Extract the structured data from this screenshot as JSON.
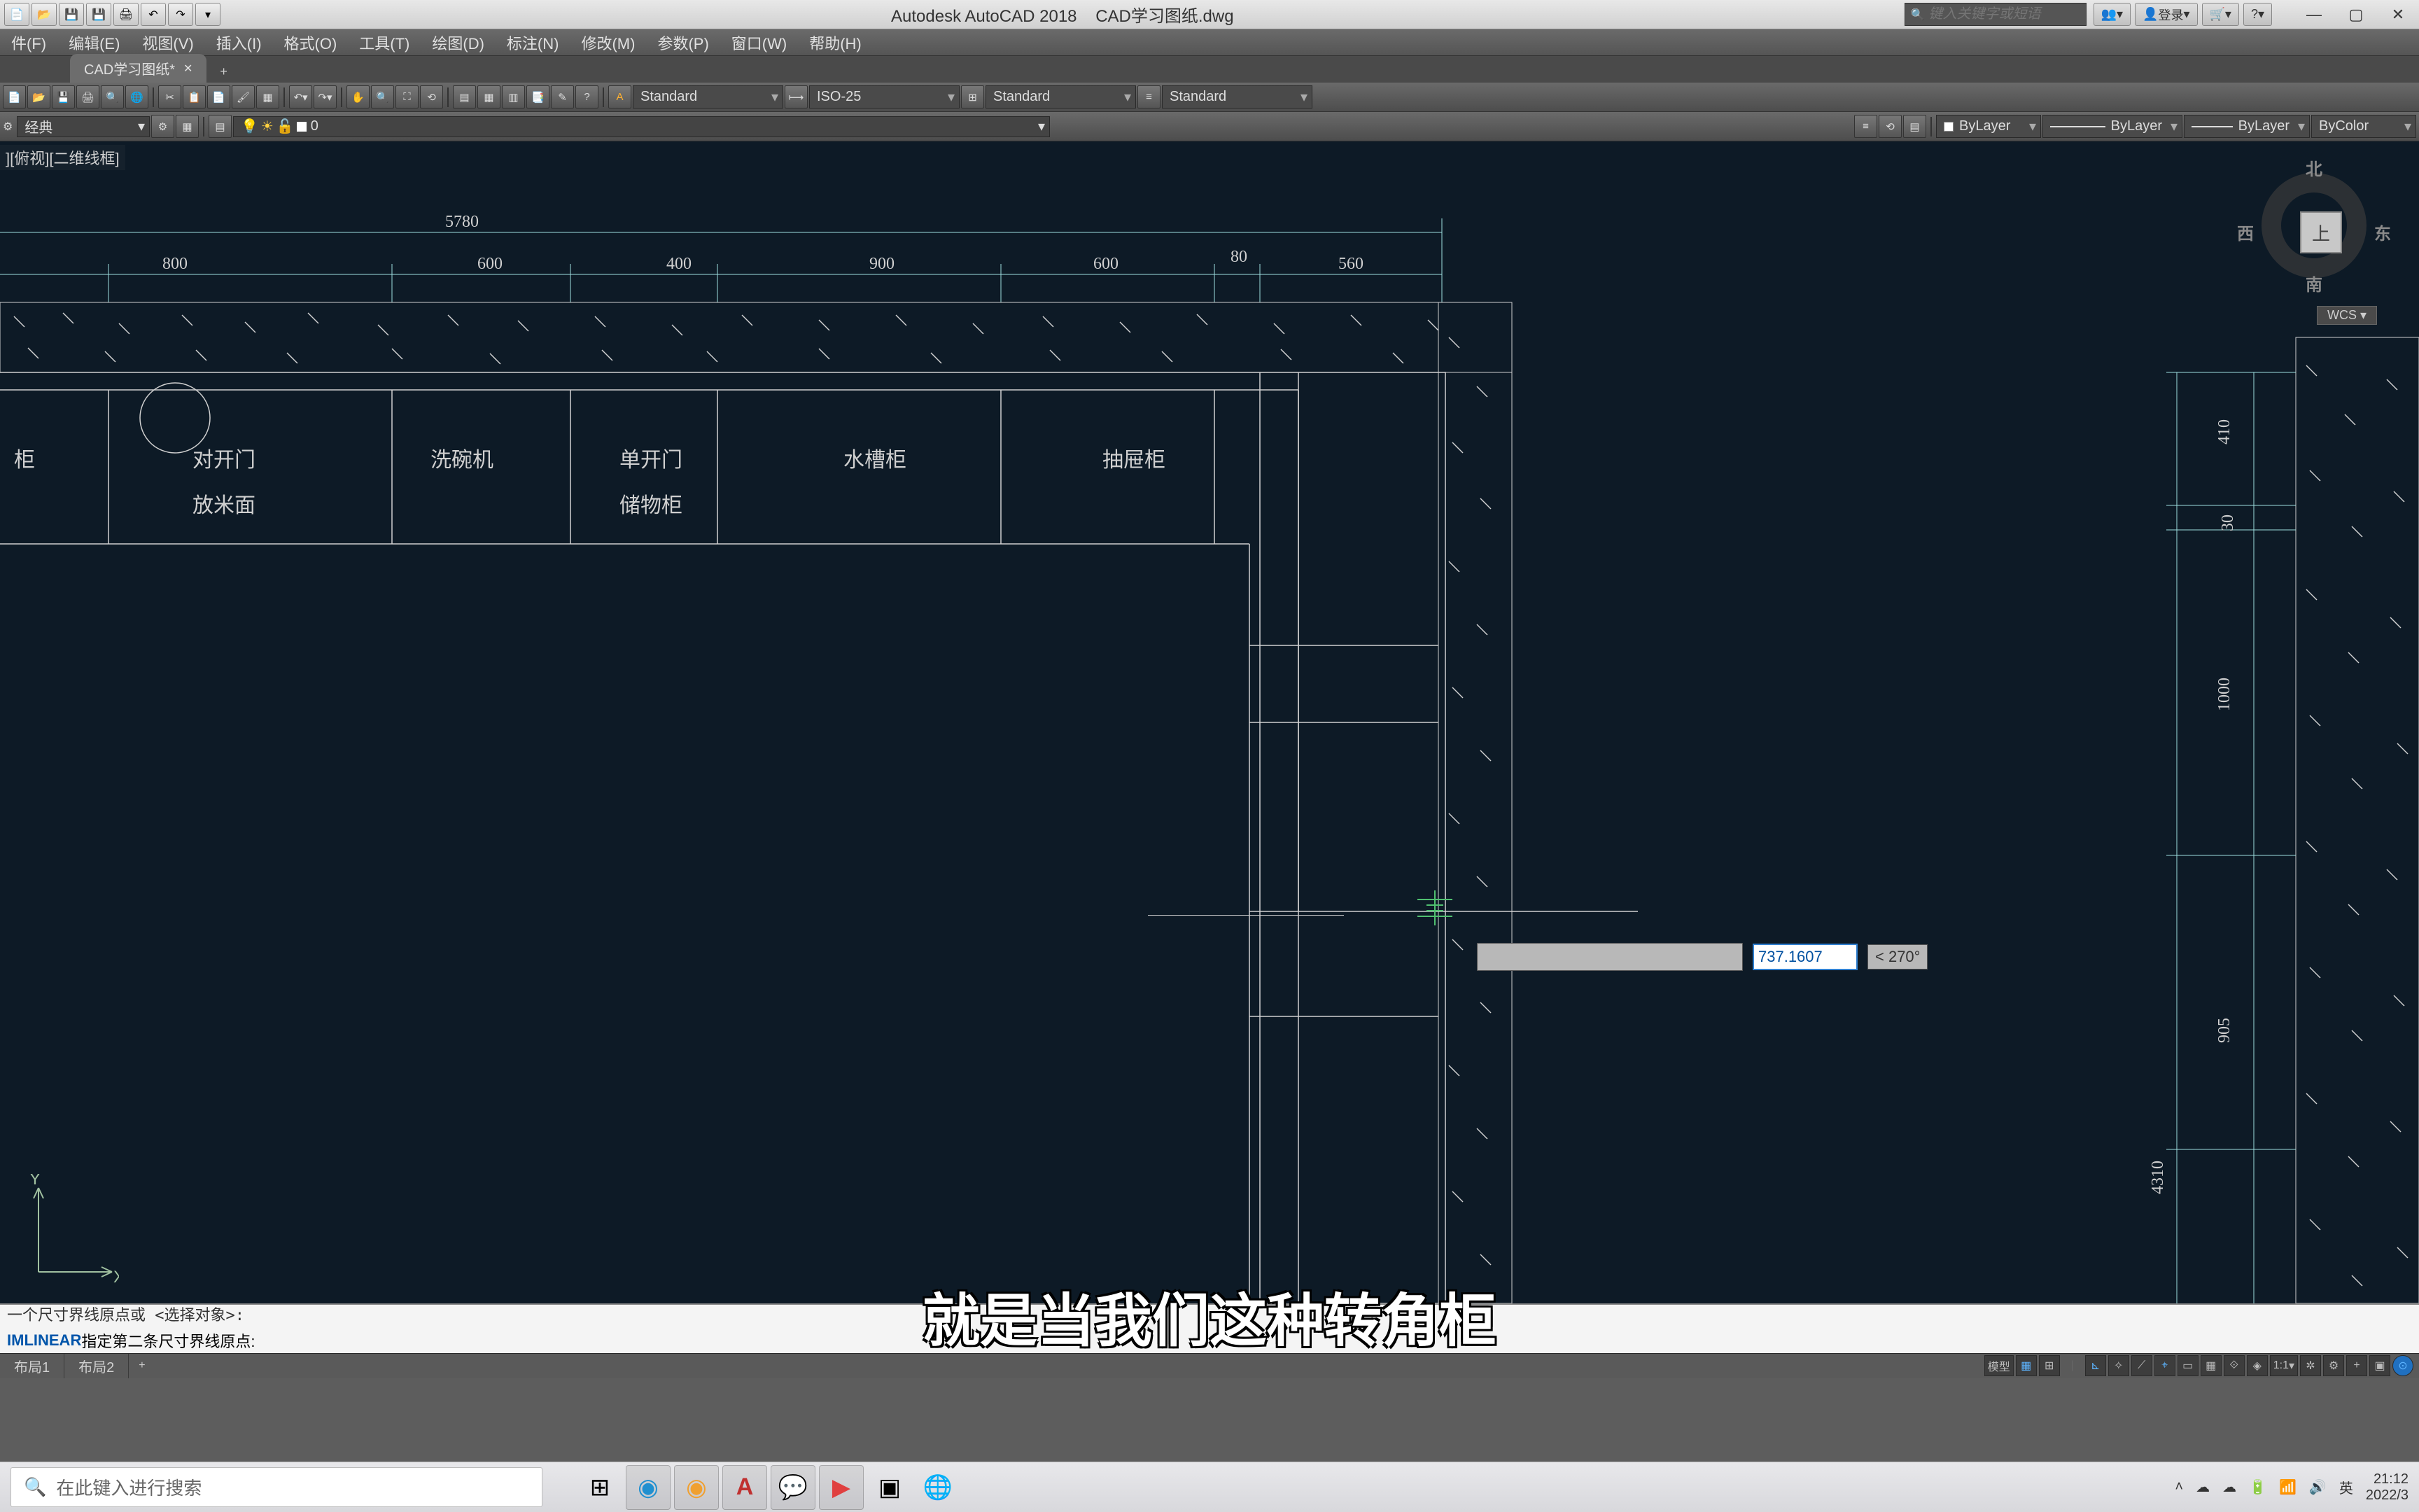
{
  "title": {
    "app": "Autodesk AutoCAD 2018",
    "file": "CAD学习图纸.dwg"
  },
  "search_placeholder": "键入关键字或短语",
  "login": "登录",
  "menus": [
    "件(F)",
    "编辑(E)",
    "视图(V)",
    "插入(I)",
    "格式(O)",
    "工具(T)",
    "绘图(D)",
    "标注(N)",
    "修改(M)",
    "参数(P)",
    "窗口(W)",
    "帮助(H)"
  ],
  "file_tab": {
    "name": "CAD学习图纸*",
    "add": "+"
  },
  "styles": {
    "text": "Standard",
    "dim": "ISO-25",
    "table": "Standard",
    "ml": "Standard"
  },
  "layers": {
    "combo": "0",
    "bylayer": "ByLayer",
    "bycolor": "ByColor"
  },
  "workspace": "经典",
  "viewport_label": "][俯视][二维线框]",
  "viewcube": {
    "top": "上",
    "n": "北",
    "s": "南",
    "e": "东",
    "w": "西",
    "wcs": "WCS ▾"
  },
  "dims_top": {
    "total": "5780",
    "segs": [
      "800",
      "600",
      "400",
      "900",
      "600",
      "80",
      "560"
    ],
    "seg80": "80"
  },
  "dims_right": [
    "410",
    "30",
    "1000",
    "905",
    "4310"
  ],
  "cabinets": [
    "柜",
    "对开门",
    "放米面",
    "洗碗机",
    "单开门",
    "储物柜",
    "水槽柜",
    "抽屉柜"
  ],
  "dyn": {
    "value": "737.1607",
    "angle": "< 270°"
  },
  "cmd": {
    "hist": "一个尺寸界线原点或 <选择对象>:",
    "prefix": "IMLINEAR",
    "prompt": " 指定第二条尺寸界线原点:"
  },
  "layouts": {
    "model": "模型",
    "l1": "布局1",
    "l2": "布局2",
    "scale": "1:1"
  },
  "subtitle": "就是当我们这种转角柜",
  "taskbar": {
    "search": "在此键入进行搜索",
    "ime": "英",
    "time": "21:12",
    "date": "2022/3"
  }
}
